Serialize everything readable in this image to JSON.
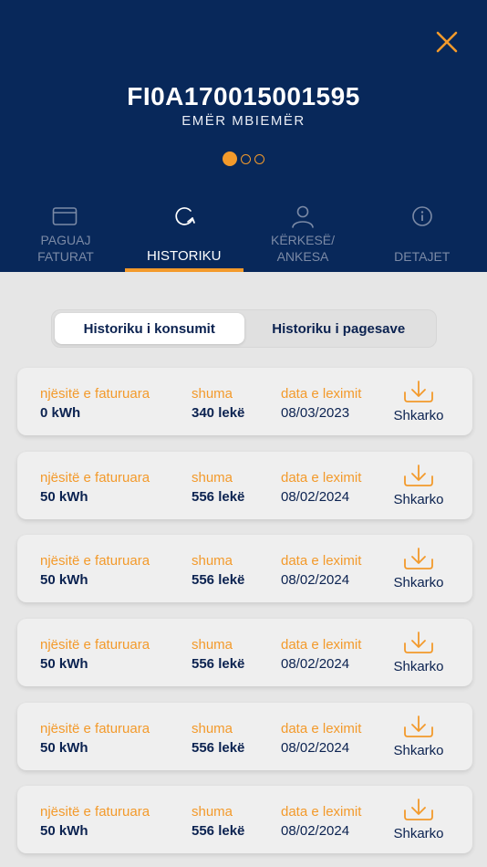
{
  "header": {
    "account_number": "FI0A170015001595",
    "account_name": "EMËR MBIEMËR",
    "close_icon": "close-icon",
    "pager": {
      "count": 3,
      "active_index": 0
    },
    "accent_color": "#f39a2b",
    "background_color": "#08285a"
  },
  "tabs": [
    {
      "id": "pay",
      "label": "PAGUAJ FATURAT",
      "icon": "credit-card-icon",
      "active": false
    },
    {
      "id": "history",
      "label": "HISTORIKU",
      "icon": "history-refresh-icon",
      "active": true
    },
    {
      "id": "request",
      "label": "KËRKESË/ ANKESA",
      "icon": "user-icon",
      "active": false
    },
    {
      "id": "details",
      "label": "DETAJET",
      "icon": "info-icon",
      "active": false
    }
  ],
  "segments": {
    "consumption": "Historiku i konsumit",
    "payments": "Historiku i pagesave",
    "active": "consumption"
  },
  "records": [
    {
      "units_label": "njësitë e faturuara",
      "units": "0 kWh",
      "amount_label": "shuma",
      "amount": "340 lekë",
      "date_label": "data e leximit",
      "date": "08/03/2023",
      "download_label": "Shkarko"
    },
    {
      "units_label": "njësitë e faturuara",
      "units": "50 kWh",
      "amount_label": "shuma",
      "amount": "556 lekë",
      "date_label": "data e leximit",
      "date": "08/02/2024",
      "download_label": "Shkarko"
    },
    {
      "units_label": "njësitë e faturuara",
      "units": "50 kWh",
      "amount_label": "shuma",
      "amount": "556 lekë",
      "date_label": "data e leximit",
      "date": "08/02/2024",
      "download_label": "Shkarko"
    },
    {
      "units_label": "njësitë e faturuara",
      "units": "50 kWh",
      "amount_label": "shuma",
      "amount": "556 lekë",
      "date_label": "data e leximit",
      "date": "08/02/2024",
      "download_label": "Shkarko"
    },
    {
      "units_label": "njësitë e faturuara",
      "units": "50 kWh",
      "amount_label": "shuma",
      "amount": "556 lekë",
      "date_label": "data e leximit",
      "date": "08/02/2024",
      "download_label": "Shkarko"
    },
    {
      "units_label": "njësitë e faturuara",
      "units": "50 kWh",
      "amount_label": "shuma",
      "amount": "556 lekë",
      "date_label": "data e leximit",
      "date": "08/02/2024",
      "download_label": "Shkarko"
    }
  ]
}
